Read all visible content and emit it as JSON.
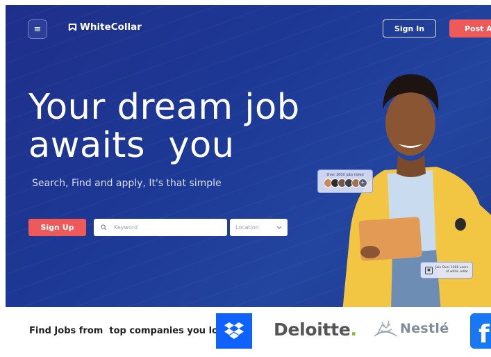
{
  "header": {
    "menu_icon": "hamburger-icon",
    "logo_text": "WhiteCollar",
    "logo_icon": "whitecollar-logo-icon",
    "signin_label": "Sign In",
    "post_job_label": "Post A job"
  },
  "hero": {
    "headline_line1": "Your dream job",
    "headline_line2": "awaits  you",
    "subheadline": "Search, Find and apply, It's that simple",
    "signup_label": "Sign Up",
    "keyword_placeholder": "Keyword",
    "location_placeholder": "Location",
    "jobs_card_text": "Over 3000 jobs listed",
    "jobs_card_more": "+",
    "join_card_line1": "Join Over 1000 users",
    "join_card_line2": "of white collar"
  },
  "companies": {
    "title": "Find Jobs from  top companies you love",
    "deloitte": "Deloitte",
    "deloitte_dot": ".",
    "nestle": "Nestlé",
    "facebook": "f"
  },
  "colors": {
    "hero_bg": "#1f3a8f",
    "accent": "#ee5a5a",
    "dropbox": "#0f62fe",
    "facebook": "#1877f2",
    "deloitte_green": "#86bc25"
  }
}
